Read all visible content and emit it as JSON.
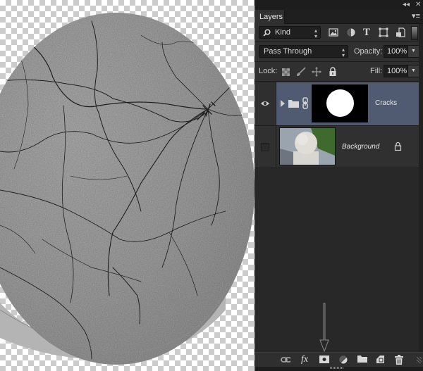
{
  "canvas": {
    "description": "Cracked concrete sphere texture on transparent background",
    "transparency_colors": [
      "#ffffff",
      "#cccccc"
    ]
  },
  "panel": {
    "window_controls": {
      "collapse": "◂◂",
      "close": "✕"
    },
    "tab_label": "Layers",
    "menu_icon": "panel-menu-icon",
    "filter": {
      "kind_label": "Kind",
      "filter_icons": [
        "pixel-layer-filter-icon",
        "adjustment-layer-filter-icon",
        "type-layer-filter-icon",
        "shape-layer-filter-icon",
        "smart-object-filter-icon"
      ],
      "type_glyph": "T"
    },
    "blend_mode": "Pass Through",
    "opacity_label": "Opacity:",
    "opacity_value": "100%",
    "lock_label": "Lock:",
    "lock_icons": [
      "lock-transparent-pixels-icon",
      "lock-image-pixels-icon",
      "lock-position-icon",
      "lock-all-icon"
    ],
    "fill_label": "Fill:",
    "fill_value": "100%",
    "layers": [
      {
        "name": "Cracks",
        "type": "group",
        "visible": true,
        "selected": true,
        "has_mask": true,
        "linked": true
      },
      {
        "name": "Background",
        "type": "pixel",
        "visible": false,
        "selected": false,
        "locked": true
      }
    ],
    "bottom_icons": [
      "link-layers-icon",
      "fx-icon",
      "add-layer-mask-icon",
      "new-fill-adjustment-layer-icon",
      "new-group-icon",
      "new-layer-icon",
      "delete-layer-icon"
    ],
    "fx_label": "fx",
    "accent_selected": "#505a70"
  }
}
